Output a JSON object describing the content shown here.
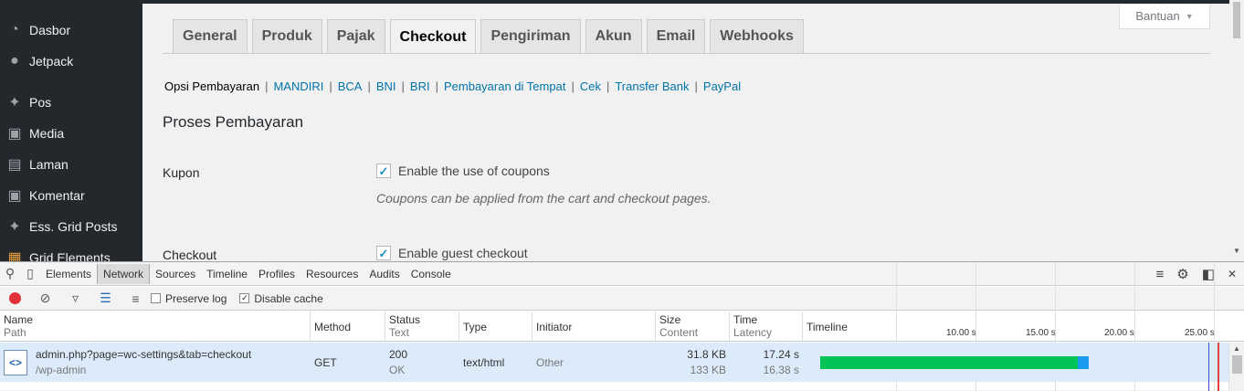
{
  "sidebar": {
    "items": [
      {
        "label": "Dasbor",
        "icon": "dashboard-icon"
      },
      {
        "label": "Jetpack",
        "icon": "jetpack-icon"
      },
      {
        "label": "Pos",
        "icon": "pin-icon"
      },
      {
        "label": "Media",
        "icon": "media-icon"
      },
      {
        "label": "Laman",
        "icon": "page-icon"
      },
      {
        "label": "Komentar",
        "icon": "comment-icon"
      },
      {
        "label": "Ess. Grid Posts",
        "icon": "pin-icon"
      },
      {
        "label": "Grid Elements",
        "icon": "grid-icon"
      }
    ]
  },
  "help": {
    "label": "Bantuan"
  },
  "tabs": [
    "General",
    "Produk",
    "Pajak",
    "Checkout",
    "Pengiriman",
    "Akun",
    "Email",
    "Webhooks"
  ],
  "active_tab": "Checkout",
  "subsections": [
    "Opsi Pembayaran",
    "MANDIRI",
    "BCA",
    "BNI",
    "BRI",
    "Pembayaran di Tempat",
    "Cek",
    "Transfer Bank",
    "PayPal"
  ],
  "section_title": "Proses Pembayaran",
  "settings": {
    "coupon_label": "Kupon",
    "coupon_check": "Enable the use of coupons",
    "coupon_desc": "Coupons can be applied from the cart and checkout pages.",
    "checkout_label": "Checkout",
    "checkout_check": "Enable guest checkout"
  },
  "devtools": {
    "tabs": [
      "Elements",
      "Network",
      "Sources",
      "Timeline",
      "Profiles",
      "Resources",
      "Audits",
      "Console"
    ],
    "active_tab": "Network",
    "preserve_log": "Preserve log",
    "disable_cache": "Disable cache",
    "preserve_log_checked": false,
    "disable_cache_checked": true,
    "columns": {
      "name": "Name",
      "path": "Path",
      "method": "Method",
      "status": "Status",
      "text": "Text",
      "type": "Type",
      "initiator": "Initiator",
      "size": "Size",
      "content": "Content",
      "time": "Time",
      "latency": "Latency",
      "timeline": "Timeline"
    },
    "timeline_ticks": [
      "10.00 s",
      "15.00 s",
      "20.00 s",
      "25.00 s"
    ],
    "request": {
      "name": "admin.php?page=wc-settings&tab=checkout",
      "path": "/wp-admin",
      "method": "GET",
      "status": "200",
      "status_text": "OK",
      "type": "text/html",
      "initiator": "Other",
      "size": "31.8 KB",
      "content": "133 KB",
      "time": "17.24 s",
      "latency": "16.38 s"
    }
  },
  "colors": {
    "accent": "#0073aa",
    "wait": "#00c455",
    "receive": "#1a9bf0",
    "record": "#e0303b",
    "sidebar": "#23282d"
  }
}
